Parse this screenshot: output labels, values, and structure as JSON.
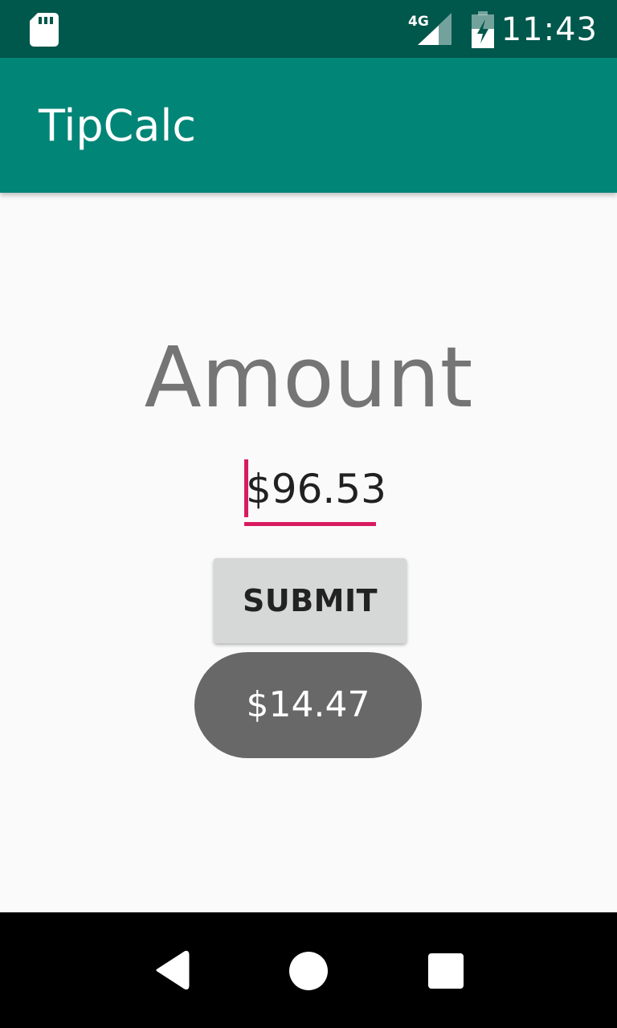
{
  "status_bar": {
    "time": "11:43",
    "network_label": "4G",
    "background_color": "#00574b",
    "icons": [
      "sd-card-icon",
      "signal-icon",
      "battery-icon"
    ]
  },
  "app_bar": {
    "title": "TipCalc",
    "background_color": "#008577"
  },
  "main": {
    "amount_label": "Amount",
    "amount_input_value": "$96.53",
    "submit_label": "SUBMIT",
    "result": "$14.47",
    "accent_color": "#d81b60"
  },
  "nav_bar": {
    "icons": [
      "back-icon",
      "home-icon",
      "recents-icon"
    ]
  }
}
